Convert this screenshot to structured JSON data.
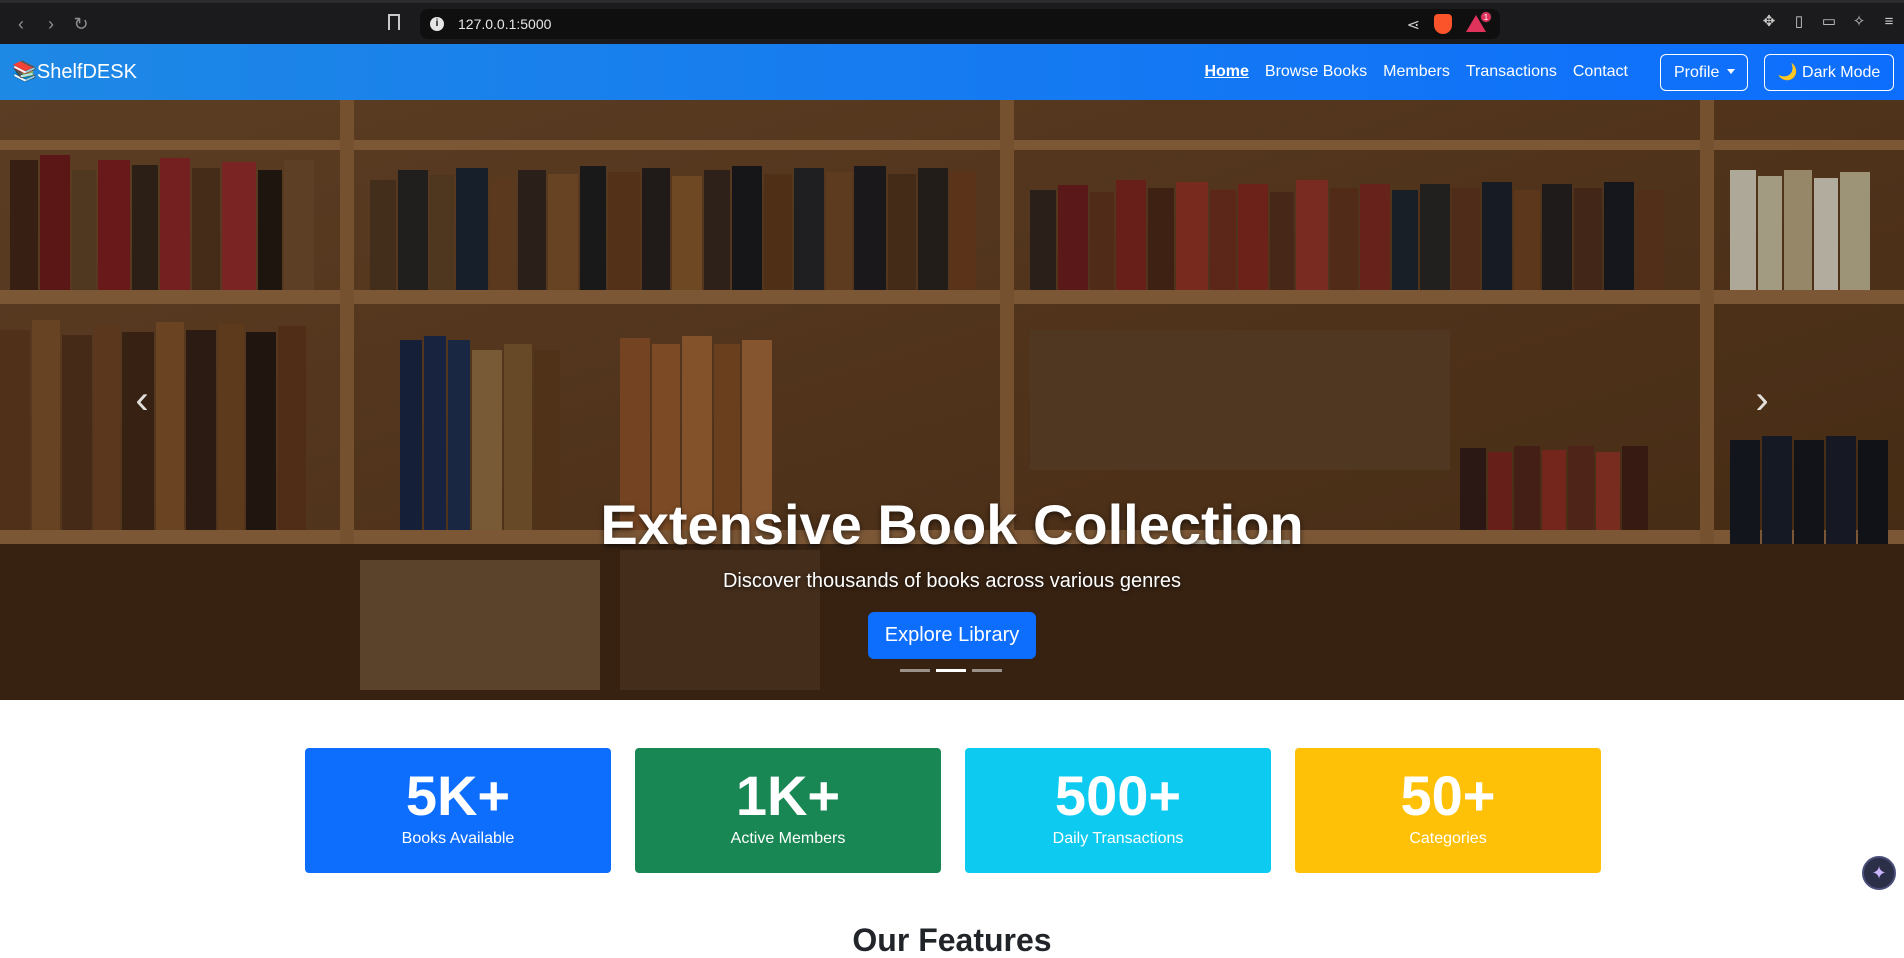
{
  "browser": {
    "url": "127.0.0.1:5000",
    "rewards_badge": "1"
  },
  "navbar": {
    "brand": "📚ShelfDESK",
    "links": [
      "Home",
      "Browse Books",
      "Members",
      "Transactions",
      "Contact"
    ],
    "active_link": "Home",
    "profile_label": "Profile",
    "dark_mode_label": "🌙 Dark Mode"
  },
  "hero": {
    "title": "Extensive Book Collection",
    "subtitle": "Discover thousands of books across various genres",
    "cta_label": "Explore Library",
    "slide_count": 3,
    "active_slide": 2
  },
  "stats": [
    {
      "value": "5K+",
      "label": "Books Available",
      "color": "#0d6efd"
    },
    {
      "value": "1K+",
      "label": "Active Members",
      "color": "#198754"
    },
    {
      "value": "500+",
      "label": "Daily Transactions",
      "color": "#0dcaf0"
    },
    {
      "value": "50+",
      "label": "Categories",
      "color": "#ffc107"
    }
  ],
  "features": {
    "title": "Our Features"
  },
  "colors": {
    "navbar": "#1e88e5",
    "primary": "#0d6efd"
  }
}
